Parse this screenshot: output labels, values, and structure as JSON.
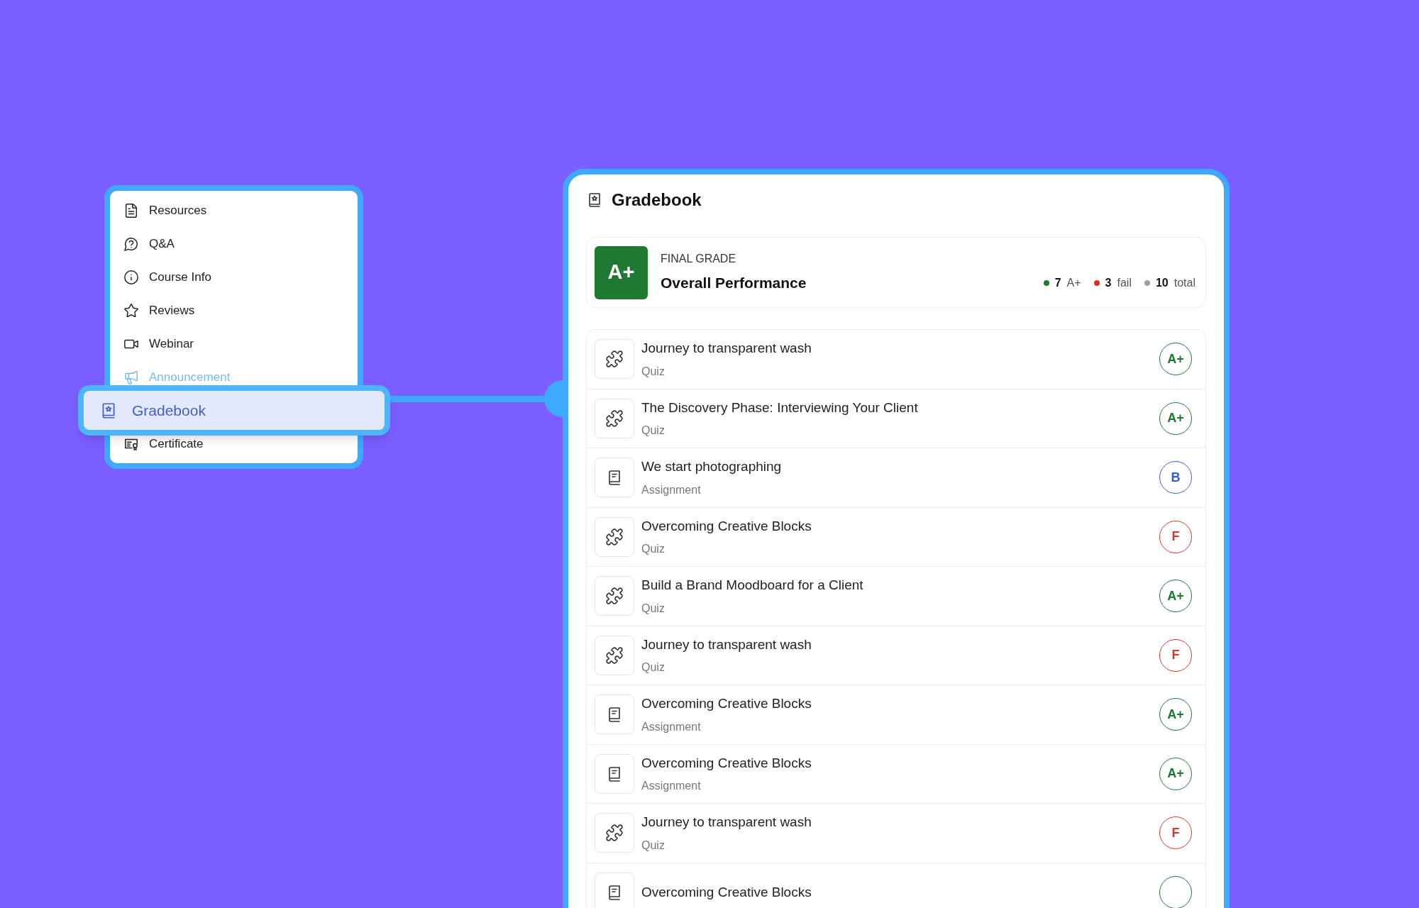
{
  "sidebar": {
    "items": [
      {
        "label": "Resources",
        "kind": "document",
        "selected": false
      },
      {
        "label": "Q&A",
        "kind": "question",
        "selected": false
      },
      {
        "label": "Course Info",
        "kind": "info",
        "selected": false
      },
      {
        "label": "Reviews",
        "kind": "star",
        "selected": false
      },
      {
        "label": "Webinar",
        "kind": "video",
        "selected": false
      },
      {
        "label": "Announcement",
        "kind": "megaphone",
        "selected": false
      },
      {
        "label": "Gradebook",
        "kind": "gradebook",
        "selected": true
      },
      {
        "label": "Certificate",
        "kind": "certificate",
        "selected": false
      }
    ]
  },
  "panel": {
    "title": "Gradebook",
    "summary": {
      "grade": "A+",
      "label": "FINAL GRADE",
      "title": "Overall Performance",
      "stats": [
        {
          "count": "7",
          "label": "A+",
          "color": "#1e7a32"
        },
        {
          "count": "3",
          "label": "fail",
          "color": "#d93025"
        },
        {
          "count": "10",
          "label": "total",
          "color": "#9e9e9e"
        }
      ]
    },
    "rows": [
      {
        "title": "Journey to transparent wash",
        "type": "Quiz",
        "kind": "quiz",
        "grade": "A+",
        "color": "#1e7a32"
      },
      {
        "title": "The Discovery Phase: Interviewing Your Client",
        "type": "Quiz",
        "kind": "quiz",
        "grade": "A+",
        "color": "#1e7a32"
      },
      {
        "title": "We start photographing",
        "type": "Assignment",
        "kind": "assignment",
        "grade": "B",
        "color": "#3b5bd6"
      },
      {
        "title": "Overcoming Creative Blocks",
        "type": "Quiz",
        "kind": "quiz",
        "grade": "F",
        "color": "#d9372c"
      },
      {
        "title": "Build a Brand Moodboard for a Client",
        "type": "Quiz",
        "kind": "quiz",
        "grade": "A+",
        "color": "#1e7a32"
      },
      {
        "title": "Journey to transparent wash",
        "type": "Quiz",
        "kind": "quiz",
        "grade": "F",
        "color": "#d9372c"
      },
      {
        "title": "Overcoming Creative Blocks",
        "type": "Assignment",
        "kind": "assignment",
        "grade": "A+",
        "color": "#1e7a32"
      },
      {
        "title": "Overcoming Creative Blocks",
        "type": "Assignment",
        "kind": "assignment",
        "grade": "A+",
        "color": "#1e7a32"
      },
      {
        "title": "Journey to transparent wash",
        "type": "Quiz",
        "kind": "quiz",
        "grade": "F",
        "color": "#d9372c"
      },
      {
        "title": "Overcoming Creative Blocks",
        "kind": "assignment",
        "color": "#1e7a32"
      }
    ]
  }
}
